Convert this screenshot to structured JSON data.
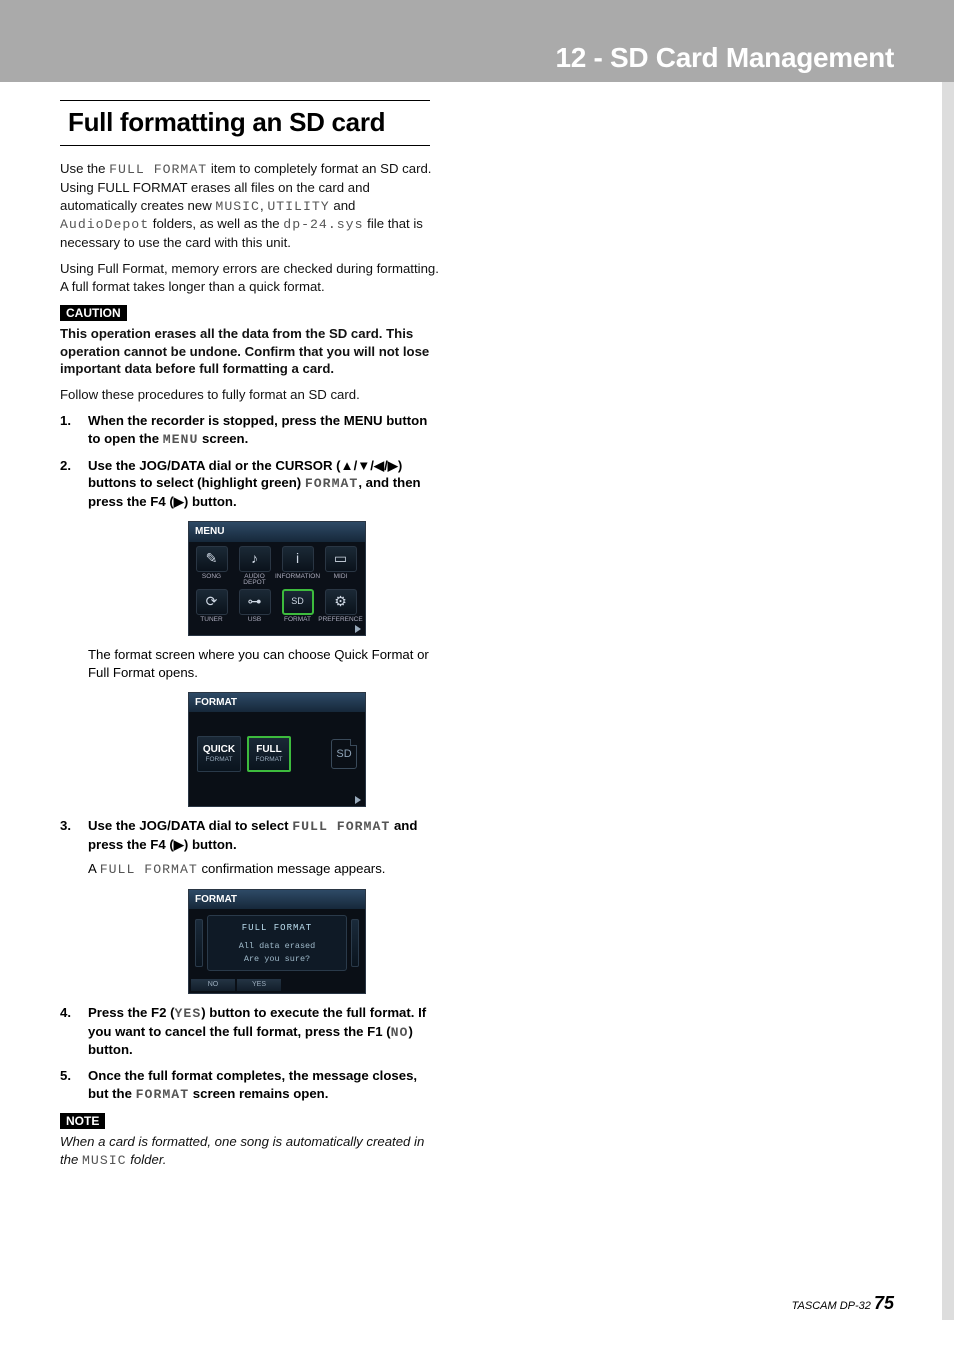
{
  "header": {
    "chapter_title": "12 - SD Card Management"
  },
  "section": {
    "title": "Full formatting an SD card"
  },
  "intro": {
    "p1a": "Use the ",
    "p1_mono1": "FULL FORMAT",
    "p1b": " item to completely format an SD card. Using FULL FORMAT erases all files on the card and automatically creates new ",
    "p1_mono2": "MUSIC",
    "p1c": ", ",
    "p1_mono3": "UTILITY",
    "p1d": " and ",
    "p1_mono4": "AudioDepot",
    "p1e": " folders, as well as the ",
    "p1_mono5": "dp-24.sys",
    "p1f": " file that is necessary to use the card with this unit.",
    "p2": "Using Full Format, memory errors are checked during formatting. A full format takes longer than a quick format."
  },
  "caution": {
    "label": "CAUTION",
    "text": "This operation erases all the data from the SD card. This operation cannot be undone. Confirm that you will not lose important data before full formatting a card."
  },
  "follow": "Follow these procedures to fully format an SD card.",
  "steps": {
    "s1": {
      "num": "1.",
      "a": "When the recorder is stopped, press the MENU button to open the ",
      "mono": "MENU",
      "b": " screen."
    },
    "s2": {
      "num": "2.",
      "a": "Use the JOG/DATA dial or the CURSOR (▲/▼/◀/▶) buttons to select (highlight green) ",
      "mono": "FORMAT",
      "b": ", and then press the F4 (▶) button.",
      "follow": "The format screen where you can choose Quick Format or Full Format opens."
    },
    "s3": {
      "num": "3.",
      "a": "Use the JOG/DATA dial to select ",
      "mono": "FULL FORMAT",
      "b": " and press the F4 (▶) button.",
      "follow_a": "A ",
      "follow_mono": "FULL FORMAT",
      "follow_b": " confirmation message appears."
    },
    "s4": {
      "num": "4.",
      "a": "Press the F2 (",
      "mono1": "YES",
      "b": ") button to execute the full format. If you want to cancel the full format, press the F1 (",
      "mono2": "NO",
      "c": ") button."
    },
    "s5": {
      "num": "5.",
      "a": "Once the full format completes, the message closes, but the ",
      "mono": "FORMAT",
      "b": " screen remains open."
    }
  },
  "note": {
    "label": "NOTE",
    "a": "When a card is formatted, one song is automatically created in the ",
    "mono": "MUSIC",
    "b": " folder."
  },
  "footer": {
    "brand": "TASCAM DP-32 ",
    "page": "75"
  },
  "menu_shot": {
    "title": "MENU",
    "items": [
      "SONG",
      "AUDIO DEPOT",
      "INFORMATION",
      "MIDI",
      "TUNER",
      "USB",
      "FORMAT",
      "PREFERENCE"
    ]
  },
  "fmt_shot": {
    "title": "FORMAT",
    "quick_t": "QUICK",
    "quick_s": "FORMAT",
    "full_t": "FULL",
    "full_s": "FORMAT",
    "sd": "SD"
  },
  "conf_shot": {
    "title": "FORMAT",
    "panel_title": "FULL FORMAT",
    "line1": "All data erased",
    "line2": "Are you sure?",
    "no": "NO",
    "yes": "YES"
  }
}
